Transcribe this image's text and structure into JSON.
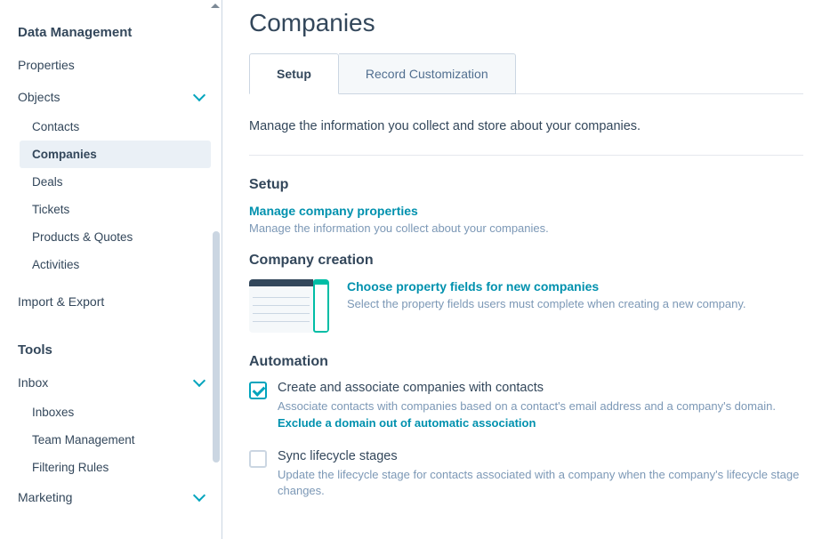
{
  "sidebar": {
    "section1_header": "Data Management",
    "properties": "Properties",
    "objects": "Objects",
    "objects_items": [
      "Contacts",
      "Companies",
      "Deals",
      "Tickets",
      "Products & Quotes",
      "Activities"
    ],
    "import_export": "Import & Export",
    "section2_header": "Tools",
    "inbox": "Inbox",
    "inbox_items": [
      "Inboxes",
      "Team Management",
      "Filtering Rules"
    ],
    "marketing": "Marketing"
  },
  "main": {
    "title": "Companies",
    "tabs": {
      "setup": "Setup",
      "record": "Record Customization"
    },
    "intro": "Manage the information you collect and store about your companies.",
    "setup_heading": "Setup",
    "manage_props_link": "Manage company properties",
    "manage_props_desc": "Manage the information you collect about your companies.",
    "creation_heading": "Company creation",
    "choose_fields_link": "Choose property fields for new companies",
    "choose_fields_desc": "Select the property fields users must complete when creating a new company.",
    "automation_heading": "Automation",
    "auto_create_label": "Create and associate companies with contacts",
    "auto_create_desc": "Associate contacts with companies based on a contact's email address and a company's domain.",
    "exclude_link": "Exclude a domain out of automatic association",
    "sync_label": "Sync lifecycle stages",
    "sync_desc": "Update the lifecycle stage for contacts associated with a company when the company's lifecycle stage changes."
  }
}
